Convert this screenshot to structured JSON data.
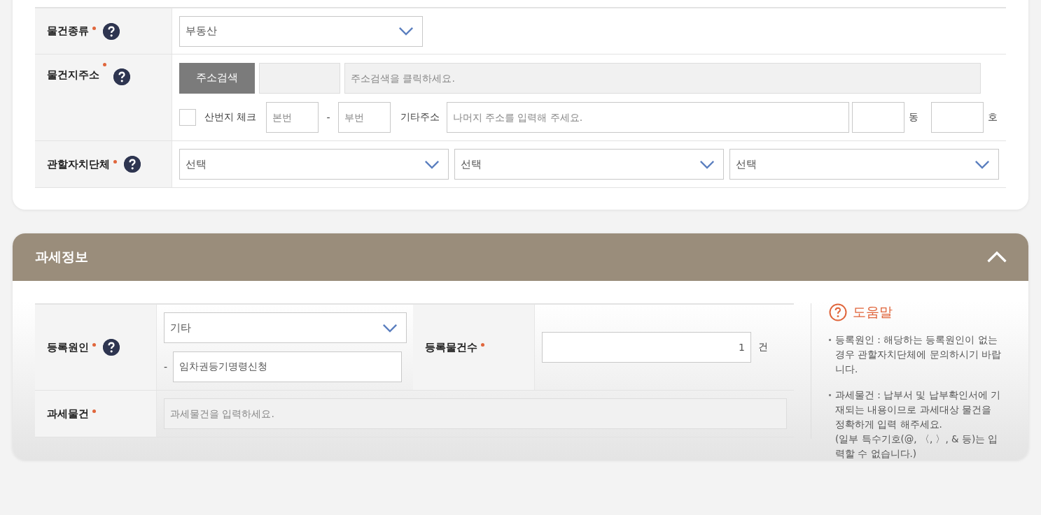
{
  "property_info": {
    "type_row": {
      "label": "물건종류",
      "required": true,
      "help": true,
      "select": "부동산"
    },
    "address_row": {
      "label": "물건지주소",
      "required": true,
      "help": true,
      "search_button": "주소검색",
      "address_placeholder": "주소검색을 클릭하세요.",
      "mountain_lot": {
        "label": "산번지 체크",
        "checked": false
      },
      "main_number_placeholder": "본번",
      "dash": "-",
      "sub_number_placeholder": "부번",
      "other_label": "기타주소",
      "other_placeholder": "나머지 주소를 입력해 주세요.",
      "dong_unit": "동",
      "ho_unit": "호"
    },
    "district_row": {
      "label": "관할자치단체",
      "required": true,
      "help": true,
      "selects": [
        "선택",
        "선택",
        "선택"
      ]
    }
  },
  "tax_info": {
    "title": "과세정보",
    "expanded": true,
    "cause_row": {
      "label": "등록원인",
      "required": true,
      "help": true,
      "select": "기타",
      "dash": "-",
      "detail_value": "임차권등기명령신청"
    },
    "count": {
      "label": "등록물건수",
      "required": true,
      "value": "1",
      "unit": "건"
    },
    "object_row": {
      "label": "과세물건",
      "required": true,
      "placeholder": "과세물건을 입력하세요."
    },
    "help": {
      "title": "도움말",
      "items": [
        {
          "text": "등록원인 : 해당하는 등록원인이 없는 경우 관할자치단체에 문의하시기 바랍니다."
        },
        {
          "text": "과세물건 : 납부서 및 납부확인서에 기재되는 내용이므로 과세대상 물건을 정확하게 입력 해주세요.",
          "note": "(일부 특수기호(@, 〈, 〉, & 등)는 입력할 수 없습니다.)"
        }
      ]
    }
  }
}
